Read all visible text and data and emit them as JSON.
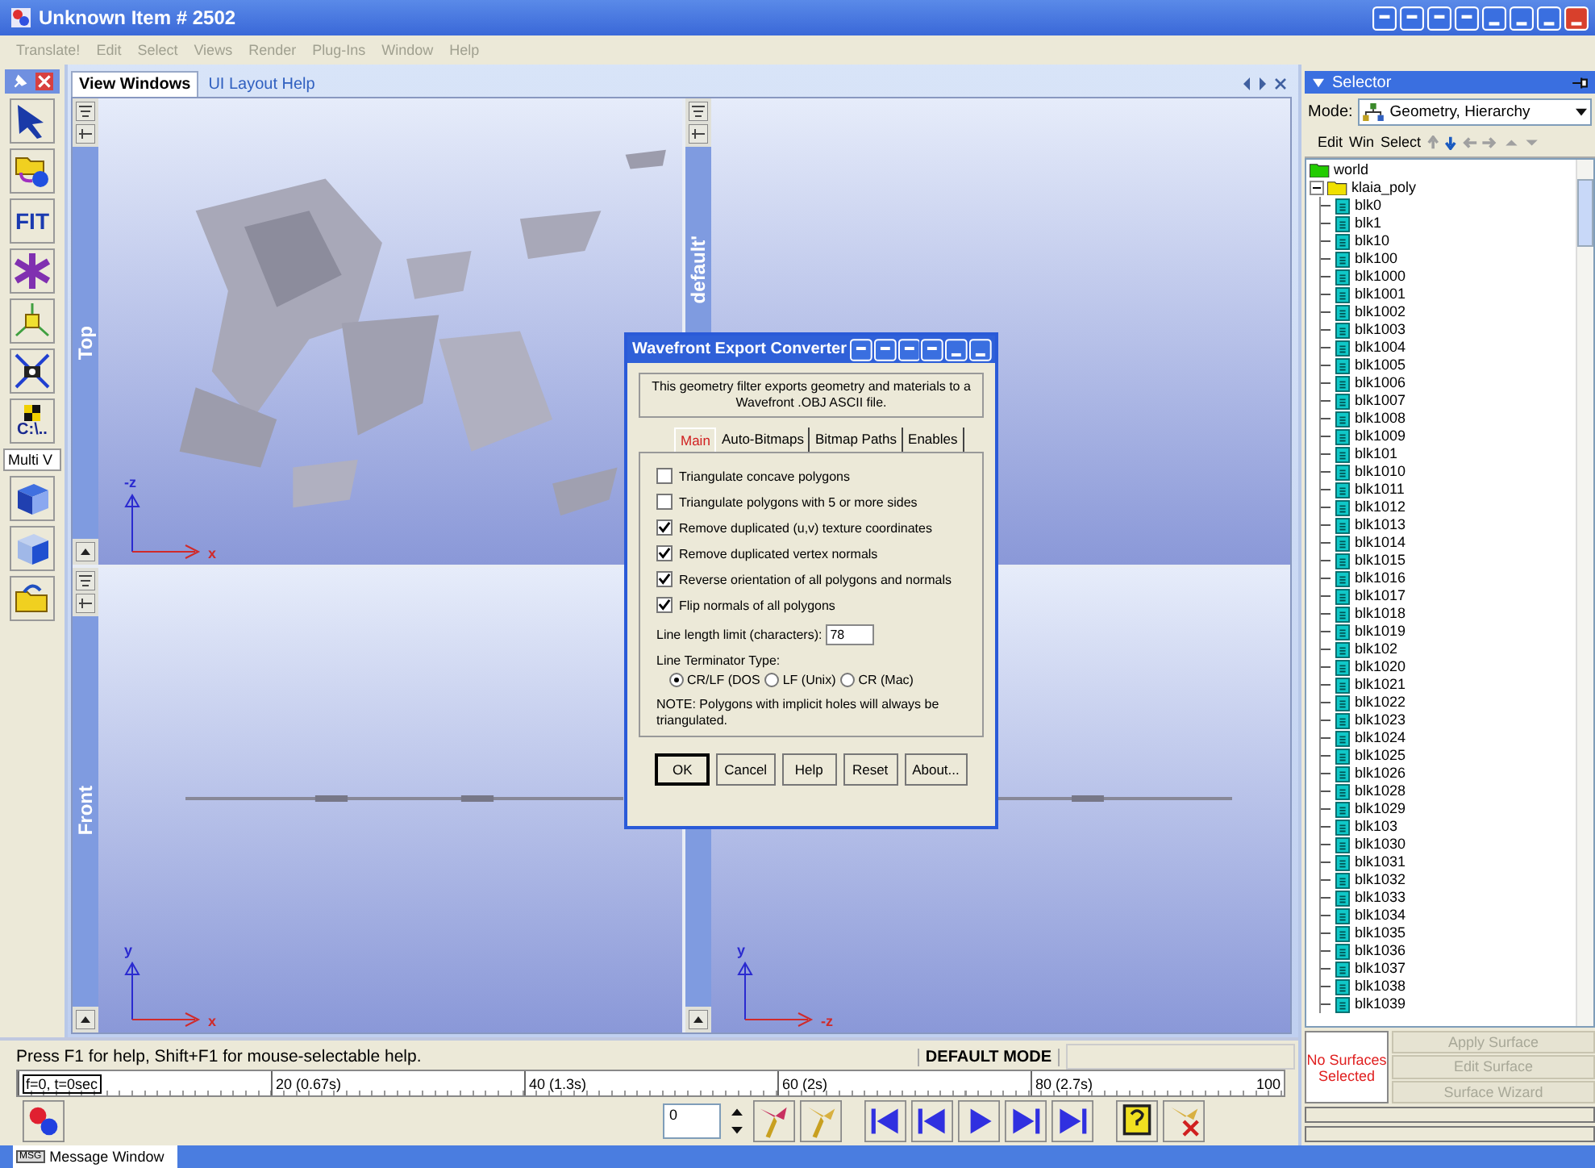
{
  "window": {
    "title": "Unknown Item # 2502"
  },
  "menu": [
    "Translate!",
    "Edit",
    "Select",
    "Views",
    "Render",
    "Plug-Ins",
    "Window",
    "Help"
  ],
  "toolbar": {
    "fit_label": "FIT",
    "path_label": "C:\\..",
    "multi_label": "Multi V"
  },
  "view_tabs": [
    {
      "label": "View Windows",
      "selected": true
    },
    {
      "label": "UI Layout Help",
      "selected": false
    }
  ],
  "viewports": [
    {
      "label": "Top",
      "kind": "plan",
      "axes": {
        "vertical": "-z",
        "horizontal": "x"
      }
    },
    {
      "label": "default'",
      "kind": "perspective"
    },
    {
      "label": "Front",
      "kind": "elevation",
      "axes": {
        "vertical": "y",
        "horizontal": "x"
      }
    },
    {
      "kind": "elevation",
      "axes": {
        "vertical": "y",
        "horizontal": "-z"
      }
    }
  ],
  "selector": {
    "title": "Selector",
    "mode_label": "Mode:",
    "mode": "Geometry, Hierarchy",
    "tools": [
      "Edit",
      "Win",
      "Select"
    ],
    "tree": [
      {
        "label": "world",
        "kind": "folder",
        "color": "#22cc00",
        "children": [
          {
            "label": "klaia_poly",
            "kind": "folder",
            "color": "#f0e000",
            "children": [
              {
                "label": "blk0",
                "kind": "mesh"
              },
              {
                "label": "blk1",
                "kind": "mesh"
              },
              {
                "label": "blk10",
                "kind": "mesh"
              },
              {
                "label": "blk100",
                "kind": "mesh"
              },
              {
                "label": "blk1000",
                "kind": "mesh"
              },
              {
                "label": "blk1001",
                "kind": "mesh"
              },
              {
                "label": "blk1002",
                "kind": "mesh"
              },
              {
                "label": "blk1003",
                "kind": "mesh"
              },
              {
                "label": "blk1004",
                "kind": "mesh"
              },
              {
                "label": "blk1005",
                "kind": "mesh"
              },
              {
                "label": "blk1006",
                "kind": "mesh"
              },
              {
                "label": "blk1007",
                "kind": "mesh"
              },
              {
                "label": "blk1008",
                "kind": "mesh"
              },
              {
                "label": "blk1009",
                "kind": "mesh"
              },
              {
                "label": "blk101",
                "kind": "mesh"
              },
              {
                "label": "blk1010",
                "kind": "mesh"
              },
              {
                "label": "blk1011",
                "kind": "mesh"
              },
              {
                "label": "blk1012",
                "kind": "mesh"
              },
              {
                "label": "blk1013",
                "kind": "mesh"
              },
              {
                "label": "blk1014",
                "kind": "mesh"
              },
              {
                "label": "blk1015",
                "kind": "mesh"
              },
              {
                "label": "blk1016",
                "kind": "mesh"
              },
              {
                "label": "blk1017",
                "kind": "mesh"
              },
              {
                "label": "blk1018",
                "kind": "mesh"
              },
              {
                "label": "blk1019",
                "kind": "mesh"
              },
              {
                "label": "blk102",
                "kind": "mesh"
              },
              {
                "label": "blk1020",
                "kind": "mesh"
              },
              {
                "label": "blk1021",
                "kind": "mesh"
              },
              {
                "label": "blk1022",
                "kind": "mesh"
              },
              {
                "label": "blk1023",
                "kind": "mesh"
              },
              {
                "label": "blk1024",
                "kind": "mesh"
              },
              {
                "label": "blk1025",
                "kind": "mesh"
              },
              {
                "label": "blk1026",
                "kind": "mesh"
              },
              {
                "label": "blk1028",
                "kind": "mesh"
              },
              {
                "label": "blk1029",
                "kind": "mesh"
              },
              {
                "label": "blk103",
                "kind": "mesh"
              },
              {
                "label": "blk1030",
                "kind": "mesh"
              },
              {
                "label": "blk1031",
                "kind": "mesh"
              },
              {
                "label": "blk1032",
                "kind": "mesh"
              },
              {
                "label": "blk1033",
                "kind": "mesh"
              },
              {
                "label": "blk1034",
                "kind": "mesh"
              },
              {
                "label": "blk1035",
                "kind": "mesh"
              },
              {
                "label": "blk1036",
                "kind": "mesh"
              },
              {
                "label": "blk1037",
                "kind": "mesh"
              },
              {
                "label": "blk1038",
                "kind": "mesh"
              },
              {
                "label": "blk1039",
                "kind": "mesh"
              }
            ]
          }
        ]
      }
    ],
    "surface_status": "No Surfaces Selected",
    "surface_buttons": [
      {
        "label": "Apply Surface",
        "disabled": true
      },
      {
        "label": "Edit Surface",
        "disabled": true
      },
      {
        "label": "Surface Wizard",
        "disabled": true
      }
    ]
  },
  "dialog": {
    "title": "Wavefront Export Converter",
    "description": "This geometry filter exports geometry and materials to a Wavefront .OBJ ASCII file.",
    "tabs": [
      {
        "label": "Main",
        "selected": true
      },
      {
        "label": "Auto-Bitmaps",
        "selected": false
      },
      {
        "label": "Bitmap Paths",
        "selected": false
      },
      {
        "label": "Enables",
        "selected": false
      }
    ],
    "options": [
      {
        "label": "Triangulate concave polygons",
        "checked": false
      },
      {
        "label": "Triangulate polygons with 5 or more sides",
        "checked": false
      },
      {
        "label": "Remove duplicated (u,v) texture coordinates",
        "checked": true
      },
      {
        "label": "Remove duplicated vertex normals",
        "checked": true
      },
      {
        "label": "Reverse orientation of all polygons and normals",
        "checked": true
      },
      {
        "label": "Flip normals of all polygons",
        "checked": true
      }
    ],
    "line_limit": {
      "label": "Line length limit (characters):",
      "value": "78"
    },
    "terminator": {
      "label": "Line Terminator Type:",
      "choices": [
        {
          "label": "CR/LF (DOS",
          "selected": true
        },
        {
          "label": "LF (Unix)",
          "selected": false
        },
        {
          "label": "CR (Mac)",
          "selected": false
        }
      ]
    },
    "note": "NOTE: Polygons with implicit holes will always be triangulated.",
    "buttons": [
      "OK",
      "Cancel",
      "Help",
      "Reset",
      "About..."
    ]
  },
  "status": {
    "help": "Press F1 for help, Shift+F1 for mouse-selectable help.",
    "mode": "DEFAULT MODE"
  },
  "timeline": [
    "f=0, t=0sec",
    "20 (0.67s)",
    "40 (1.3s)",
    "60 (2s)",
    "80 (2.7s)",
    "100"
  ],
  "frame_field": {
    "value": "0"
  },
  "taskbar": [
    {
      "icon_text": "MSG",
      "label": "Message Window"
    }
  ]
}
